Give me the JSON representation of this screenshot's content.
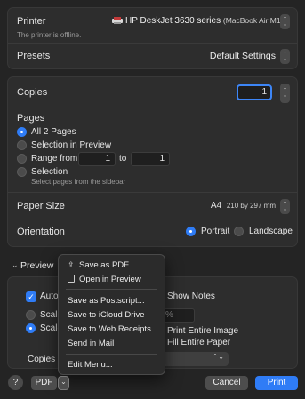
{
  "printer": {
    "label": "Printer",
    "name": "HP DeskJet 3630 series",
    "host": "(MacBook Air M1)",
    "status": "The printer is offline."
  },
  "presets": {
    "label": "Presets",
    "value": "Default Settings"
  },
  "copies": {
    "label": "Copies",
    "value": "1"
  },
  "pages": {
    "label": "Pages",
    "all": "All 2 Pages",
    "selection_preview": "Selection in Preview",
    "range_from": "Range from",
    "range_start": "1",
    "range_to": "to",
    "range_end": "1",
    "selection": "Selection",
    "selection_hint": "Select pages from the sidebar",
    "selected_option": "all"
  },
  "paper": {
    "label": "Paper Size",
    "value": "A4",
    "dims": "210 by 297 mm"
  },
  "orientation": {
    "label": "Orientation",
    "portrait": "Portrait",
    "landscape": "Landscape",
    "selected": "portrait"
  },
  "preview": {
    "label": "Preview",
    "auto": "Auto",
    "show_notes": "Show Notes",
    "scale": "Scale",
    "scale_to": "Scale",
    "percent": "%",
    "print_entire": "Print Entire Image",
    "fill_paper": "Fill Entire Paper",
    "copies_per": "Copies p"
  },
  "menu": {
    "save_pdf": "Save as PDF...",
    "open_preview": "Open in Preview",
    "save_postscript": "Save as Postscript...",
    "save_icloud": "Save to iCloud Drive",
    "save_web_receipts": "Save to Web Receipts",
    "send_mail": "Send in Mail",
    "edit_menu": "Edit Menu..."
  },
  "footer": {
    "help": "?",
    "pdf": "PDF",
    "cancel": "Cancel",
    "print": "Print"
  },
  "colors": {
    "accent": "#2f7cf6",
    "background": "#242424",
    "panel": "#2d2d2d"
  }
}
